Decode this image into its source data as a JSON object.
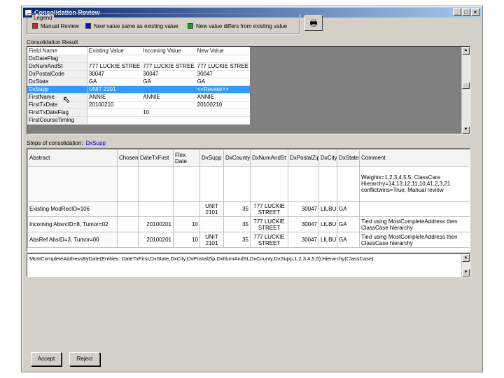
{
  "window": {
    "title": "Consolidation Review"
  },
  "legend": {
    "title": "Legend",
    "items": [
      {
        "label": "Manual Review",
        "color": "#e02020"
      },
      {
        "label": "New value same as existing value",
        "color": "#1010c0"
      },
      {
        "label": "New value differs from existing value",
        "color": "#20a020"
      }
    ]
  },
  "result": {
    "label": "Consolidation Result",
    "headers": [
      "Field Name",
      "Existing Value",
      "Incoming Value",
      "New Value"
    ],
    "rows": [
      [
        "DxDateFlag",
        "",
        "",
        ""
      ],
      [
        "DxNumAndSt",
        "777 LUCKIE STREE",
        "777 LUCKIE STREE",
        "777 LUCKIE STREE"
      ],
      [
        "DxPostalCode",
        "30047",
        "30047",
        "30047"
      ],
      [
        "DxState",
        "GA",
        "GA",
        "GA"
      ],
      [
        "DxSupp",
        "UNIT 2101",
        "",
        "<<Review>>"
      ],
      [
        "FirstName",
        "ANNIE",
        "ANNIE",
        "ANNIE"
      ],
      [
        "FirstTxDate",
        "20100210",
        "",
        "20100210"
      ],
      [
        "FirstTxDateFlag",
        "",
        "10",
        ""
      ],
      [
        "FirstCourseTiming",
        "",
        "",
        ""
      ]
    ],
    "selected_row": 4
  },
  "steps": {
    "label": "Steps of consolidation:",
    "field": "DxSupp",
    "headers": [
      "Abstract",
      "Chosen",
      "DateTxFirst",
      "Flex Date",
      "DxSupp",
      "DxCounty",
      "DxNumAndSt",
      "DxPostalZip",
      "DxCity",
      "DxState",
      "Comment"
    ],
    "rows": [
      [
        "",
        "",
        "",
        "",
        "",
        "",
        "",
        "",
        "",
        "",
        "Weights=1,2,3,4,5,5; ClassCare Hierarchy=14,13,12,11,10,41,2,3,21 conflictwins=True; Manual review"
      ],
      [
        "Existing ModRecID=106",
        "",
        "",
        "",
        "UNIT 2101",
        "35",
        "777 LUCKIE STREET",
        "30047",
        "LILBU",
        "GA",
        ""
      ],
      [
        "Incoming AbsrcID=8, Tumor=02",
        "",
        "20100201",
        "10",
        "",
        "35",
        "777 LUCKIE STREET",
        "30047",
        "LILBU",
        "GA",
        "Tied using MostCompleteAddress then ClassCase hierarchy"
      ],
      [
        "AbsRef AbsID=3, Tumor=00",
        "",
        "20100201",
        "10",
        "UNIT 2101",
        "35",
        "777 LUCKIE STREET",
        "30047",
        "LILBU",
        "GA",
        "Tied using MostCompleteAddress then ClassCase hierarchy"
      ]
    ]
  },
  "detail": {
    "text": "MostCompleteAddressByDate(Entities: DateTxFirst,DxState,DxCity,DxPostalZip,DxNumAndSt,DxCounty,DxSupp,1,2,3,4,5,5);Hierarchy(ClassCase)"
  },
  "buttons": {
    "accept": "Accept",
    "reject": "Reject"
  }
}
